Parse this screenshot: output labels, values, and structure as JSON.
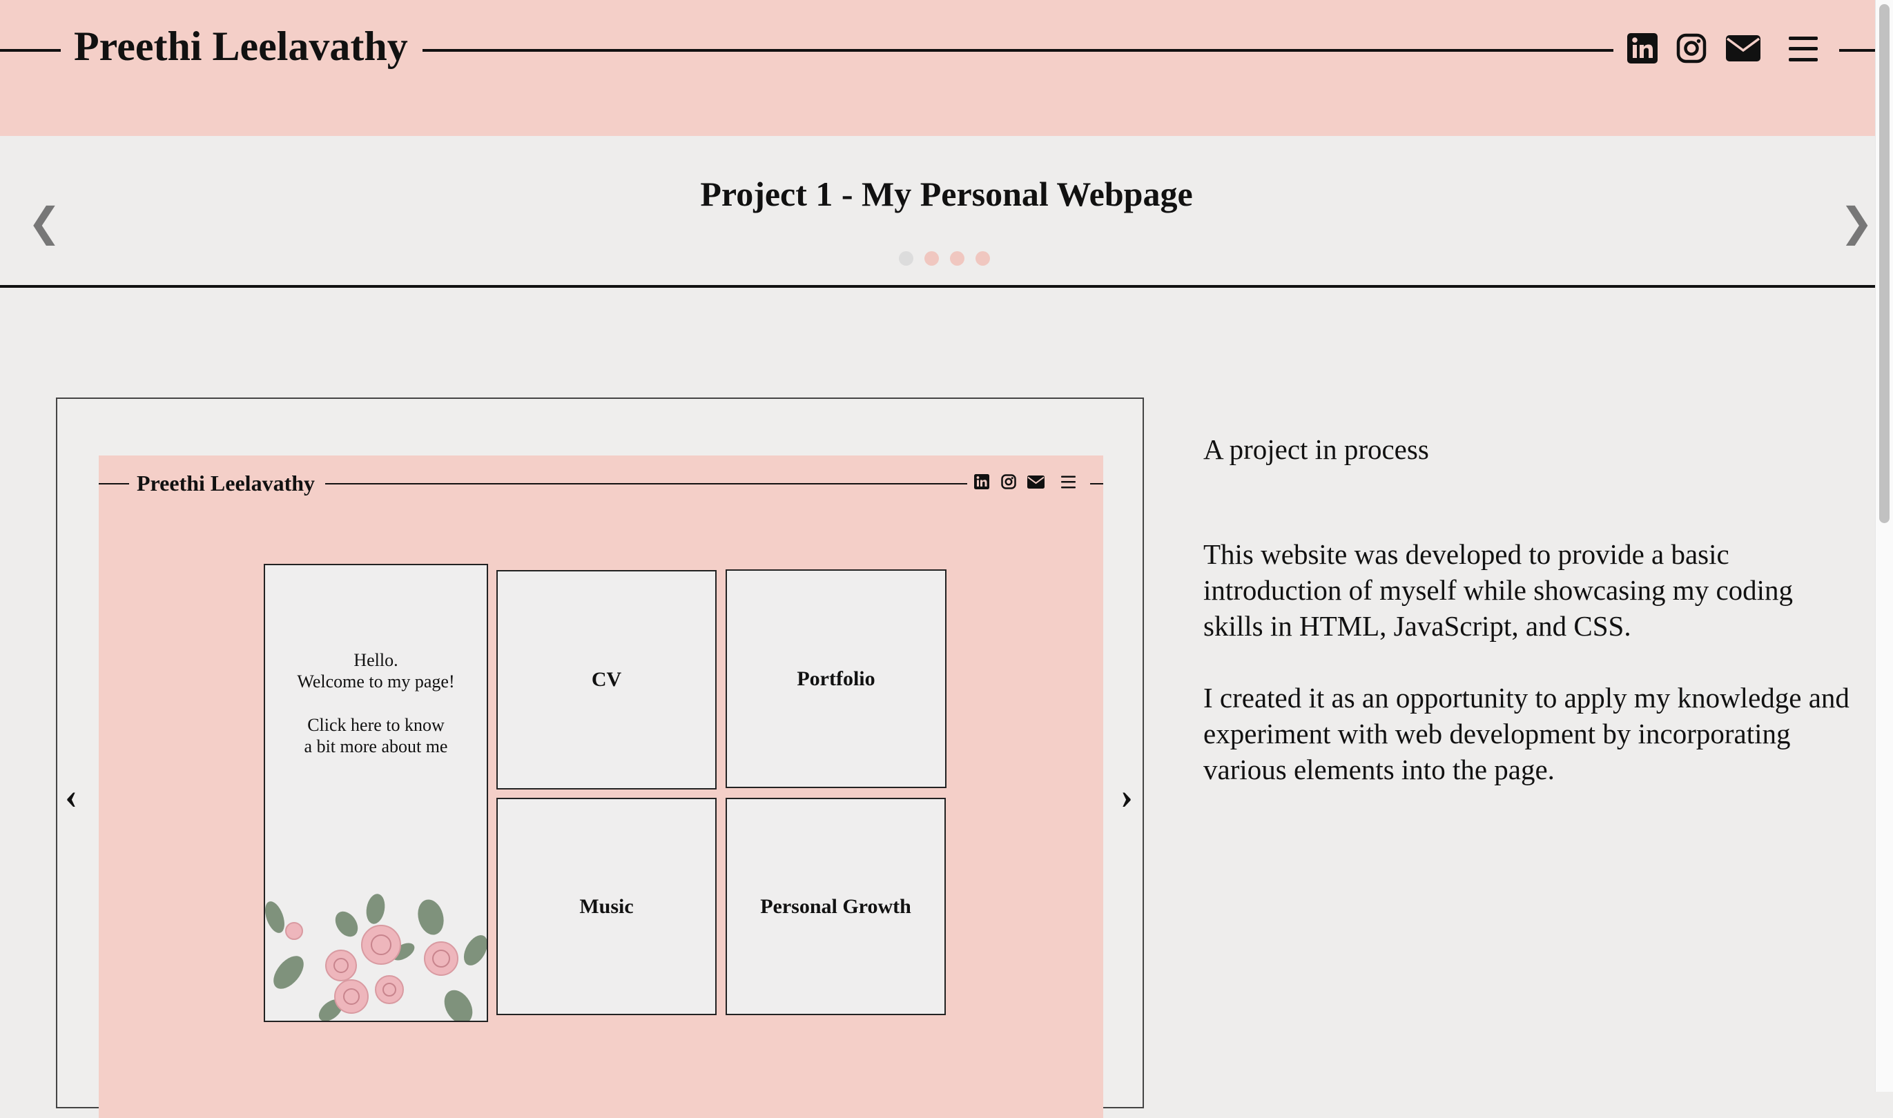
{
  "header": {
    "title": "Preethi Leelavathy",
    "icons": [
      "linkedin-icon",
      "instagram-icon",
      "mail-icon",
      "hamburger-menu-icon"
    ]
  },
  "slider": {
    "title": "Project 1 - My Personal Webpage",
    "prev_glyph": "❮",
    "next_glyph": "❯",
    "dots_total": 4,
    "active_dots": [
      2,
      3,
      4
    ]
  },
  "preview": {
    "site_title": "Preethi Leelavathy",
    "welcome": {
      "line1": "Hello.",
      "line2": "Welcome to my page!",
      "line3": "Click here to know",
      "line4": "a bit more about me"
    },
    "cards": {
      "cv": "CV",
      "portfolio": "Portfolio",
      "music": "Music",
      "growth": "Personal Growth"
    },
    "prev_glyph": "‹",
    "next_glyph": "›"
  },
  "description": {
    "lead": "A project in process",
    "p1": "This website was developed to provide a basic introduction of myself while showcasing my coding skills in HTML, JavaScript, and CSS.",
    "p2": "I created it as an opportunity to apply my knowledge and experiment with web development by incorporating various elements into the page."
  },
  "colors": {
    "header_bg": "#f4cfc8",
    "page_bg": "#eeedec",
    "dot_active": "#f0c7c0",
    "dot_inactive": "#dcdcdc"
  }
}
